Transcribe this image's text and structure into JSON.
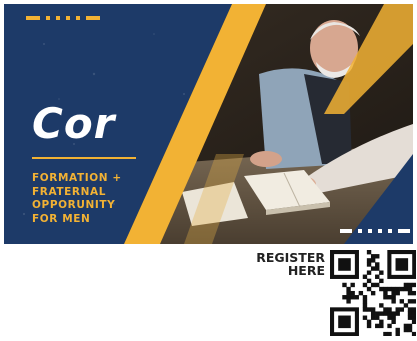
{
  "banner": {
    "title": "Cor",
    "subtitle_lines": [
      "FORMATION +",
      "FRATERNAL",
      "OPPORUNITY",
      "FOR MEN"
    ]
  },
  "register": {
    "line1": "REGISTER",
    "line2": "HERE"
  },
  "icons": {
    "qr": "qr-code-icon"
  },
  "colors": {
    "navy": "#1d3a68",
    "gold": "#f2b234",
    "text_dark": "#222222"
  }
}
